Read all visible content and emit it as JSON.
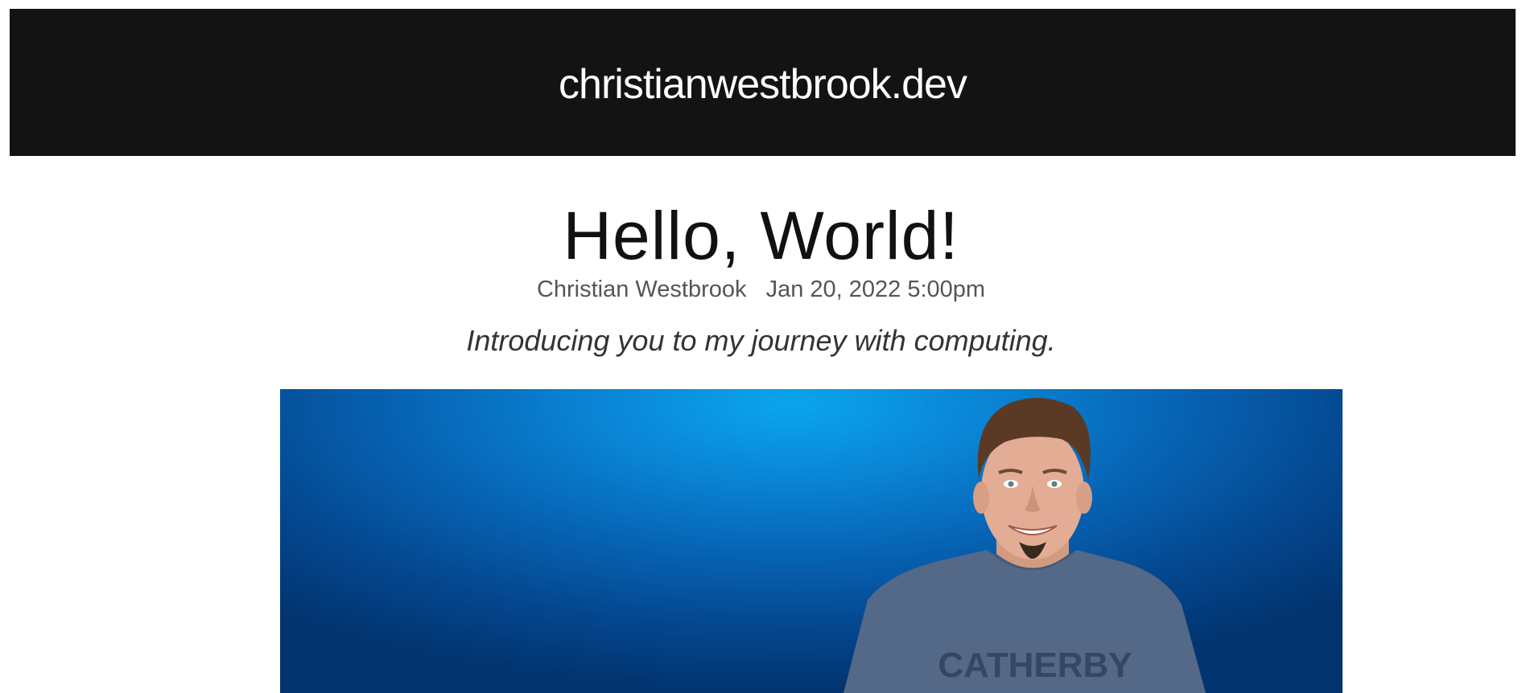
{
  "header": {
    "site_title": "christianwestbrook.dev"
  },
  "post": {
    "title": "Hello, World!",
    "author": "Christian Westbrook",
    "date": "Jan 20, 2022 5:00pm",
    "subtitle": "Introducing you to my journey with computing.",
    "hero_image": {
      "shirt_text": "CATHERBY"
    }
  },
  "colors": {
    "header_bg": "#131313",
    "hero_blue": "#0a86d6"
  }
}
